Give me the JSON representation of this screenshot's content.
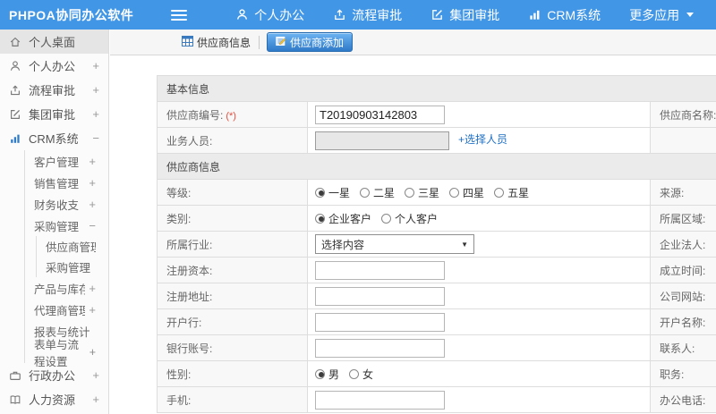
{
  "colors": {
    "navbar": "#4296e6",
    "button_accent": "#2f7ac9",
    "link": "#1d6fc4",
    "required": "#e74c3c"
  },
  "navbar": {
    "logo": "PHPOA协同办公软件",
    "items": [
      {
        "label": "个人办公",
        "icon": "user-icon"
      },
      {
        "label": "流程审批",
        "icon": "workflow-icon"
      },
      {
        "label": "集团审批",
        "icon": "edit-icon"
      },
      {
        "label": "CRM系统",
        "icon": "bar-chart-icon"
      },
      {
        "label": "更多应用",
        "icon": "caret-down-icon"
      }
    ]
  },
  "sidebar": {
    "items": [
      {
        "label": "个人桌面",
        "icon": "home-icon",
        "level": 0,
        "selected": true
      },
      {
        "label": "个人办公",
        "icon": "user-icon",
        "level": 0,
        "expand": "+"
      },
      {
        "label": "流程审批",
        "icon": "workflow-icon",
        "level": 0,
        "expand": "+"
      },
      {
        "label": "集团审批",
        "icon": "edit-icon",
        "level": 0,
        "expand": "+"
      },
      {
        "label": "CRM系统",
        "icon": "bar-chart-icon",
        "level": 0,
        "expand": "−"
      },
      {
        "label": "客户管理",
        "level": 1,
        "expand": "+"
      },
      {
        "label": "销售管理",
        "level": 1,
        "expand": "+"
      },
      {
        "label": "财务收支",
        "level": 1,
        "expand": "+"
      },
      {
        "label": "采购管理",
        "level": 1,
        "expand": "−"
      },
      {
        "label": "供应商管理",
        "level": 2
      },
      {
        "label": "采购管理",
        "level": 2
      },
      {
        "label": "产品与库存",
        "level": 1,
        "expand": "+"
      },
      {
        "label": "代理商管理",
        "level": 1,
        "expand": "+"
      },
      {
        "label": "报表与统计",
        "level": 1
      },
      {
        "label": "表单与流程设置",
        "level": 1,
        "expand": "+"
      },
      {
        "label": "行政办公",
        "icon": "briefcase-icon",
        "level": 0,
        "expand": "+"
      },
      {
        "label": "人力资源",
        "icon": "book-icon",
        "level": 0,
        "expand": "+"
      }
    ]
  },
  "tabs": {
    "list": {
      "label": "供应商信息",
      "icon": "table-icon"
    },
    "add": {
      "label": "供应商添加",
      "icon": "form-add-icon",
      "active": true
    }
  },
  "form": {
    "sections": [
      {
        "title": "基本信息"
      },
      {
        "title": "供应商信息"
      }
    ],
    "rows": [
      {
        "label": "供应商编号:",
        "required": "(*)",
        "type": "input",
        "value": "T20190903142803",
        "right_label": "供应商名称:",
        "right_required": "(*)"
      },
      {
        "label": "业务人员:",
        "type": "picker",
        "link": "+选择人员",
        "right_label": ""
      },
      {
        "label": "等级:",
        "type": "radio",
        "options": [
          "一星",
          "二星",
          "三星",
          "四星",
          "五星"
        ],
        "selected": 0,
        "right_label": "来源:"
      },
      {
        "label": "类别:",
        "type": "radio",
        "options": [
          "企业客户",
          "个人客户"
        ],
        "selected": 0,
        "right_label": "所属区域:"
      },
      {
        "label": "所属行业:",
        "type": "select",
        "value": "选择内容",
        "right_label": "企业法人:"
      },
      {
        "label": "注册资本:",
        "type": "input",
        "value": "",
        "right_label": "成立时间:"
      },
      {
        "label": "注册地址:",
        "type": "input",
        "value": "",
        "right_label": "公司网站:"
      },
      {
        "label": "开户行:",
        "type": "input",
        "value": "",
        "right_label": "开户名称:"
      },
      {
        "label": "银行账号:",
        "type": "input",
        "value": "",
        "right_label": "联系人:"
      },
      {
        "label": "性别:",
        "type": "radio",
        "options": [
          "男",
          "女"
        ],
        "selected": 0,
        "right_label": "职务:"
      },
      {
        "label": "手机:",
        "type": "input",
        "value": "",
        "right_label": "办公电话:"
      }
    ]
  }
}
